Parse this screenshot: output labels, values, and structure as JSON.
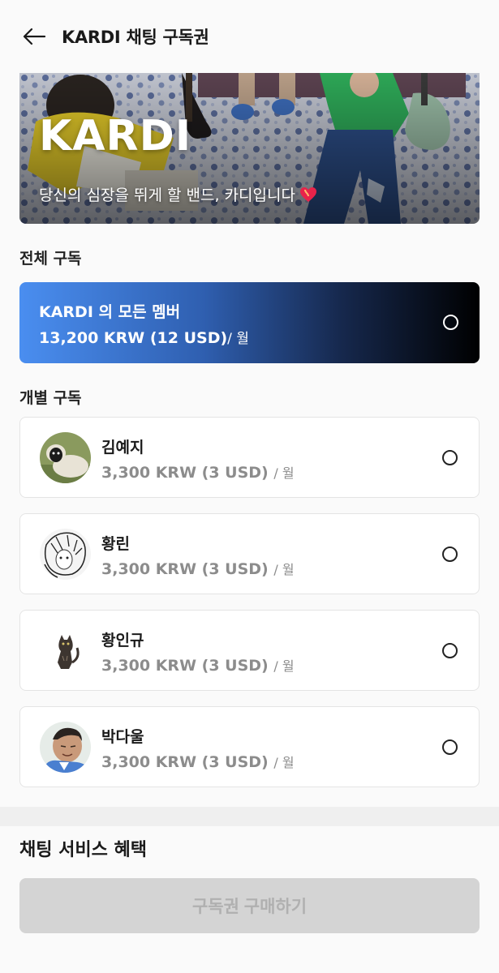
{
  "header": {
    "title": "KARDI 채팅 구독권"
  },
  "banner": {
    "name": "KARDI",
    "tagline": "당신의 심장을 뛰게 할 밴드, 카디입니다"
  },
  "sections": {
    "all": "전체 구독",
    "individual": "개별 구독",
    "benefits": "채팅 서비스 혜택"
  },
  "all_subscription": {
    "label": "KARDI 의 모든 멤버",
    "price": "13,200 KRW (12 USD)",
    "unit": "/ 월",
    "selected": false
  },
  "members": [
    {
      "name": "김예지",
      "price": "3,300 KRW (3 USD)",
      "unit": "/ 월",
      "selected": false
    },
    {
      "name": "황린",
      "price": "3,300 KRW (3 USD)",
      "unit": "/ 월",
      "selected": false
    },
    {
      "name": "황인규",
      "price": "3,300 KRW (3 USD)",
      "unit": "/ 월",
      "selected": false
    },
    {
      "name": "박다울",
      "price": "3,300 KRW (3 USD)",
      "unit": "/ 월",
      "selected": false
    }
  ],
  "purchase_button": {
    "label": "구독권 구매하기",
    "enabled": false
  },
  "colors": {
    "gradient_start": "#4a8ef0",
    "gradient_end": "#000000",
    "button_disabled": "#d4d4d4"
  },
  "icons": {
    "back": "arrow-left-icon",
    "heart": "heart-icon",
    "radio": "radio-unchecked-icon"
  }
}
